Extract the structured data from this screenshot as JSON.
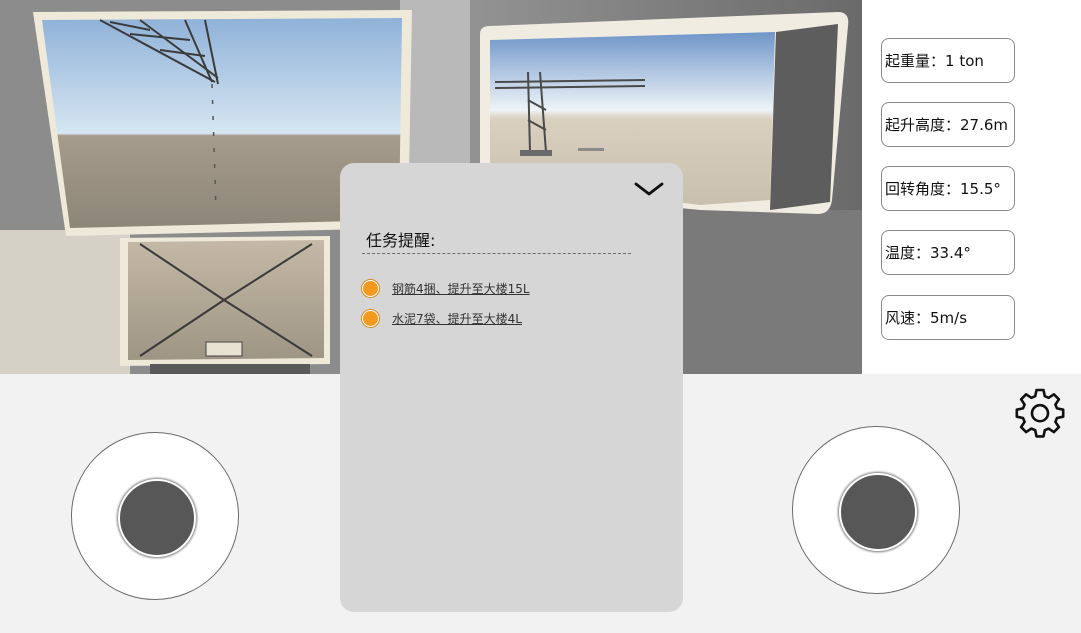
{
  "stats": [
    {
      "label": "起重量：",
      "value": "1 ton"
    },
    {
      "label": "起升高度：",
      "value": "27.6m"
    },
    {
      "label": "回转角度：",
      "value": "15.5°"
    },
    {
      "label": "温度：",
      "value": "33.4°"
    },
    {
      "label": "风速：",
      "value": "5m/s"
    }
  ],
  "task_panel": {
    "title": "任务提醒:",
    "collapse_icon": "chevron-down-icon",
    "tasks": [
      {
        "text": "钢筋4捆、提升至大楼15L"
      },
      {
        "text": "水泥7袋、提升至大楼4L"
      }
    ]
  },
  "settings": {
    "icon": "gear-icon"
  },
  "colors": {
    "task_dot": "#f39a1e",
    "panel_bg": "#d6d6d6",
    "knob": "#575757",
    "control_bg": "#f2f2f2"
  }
}
